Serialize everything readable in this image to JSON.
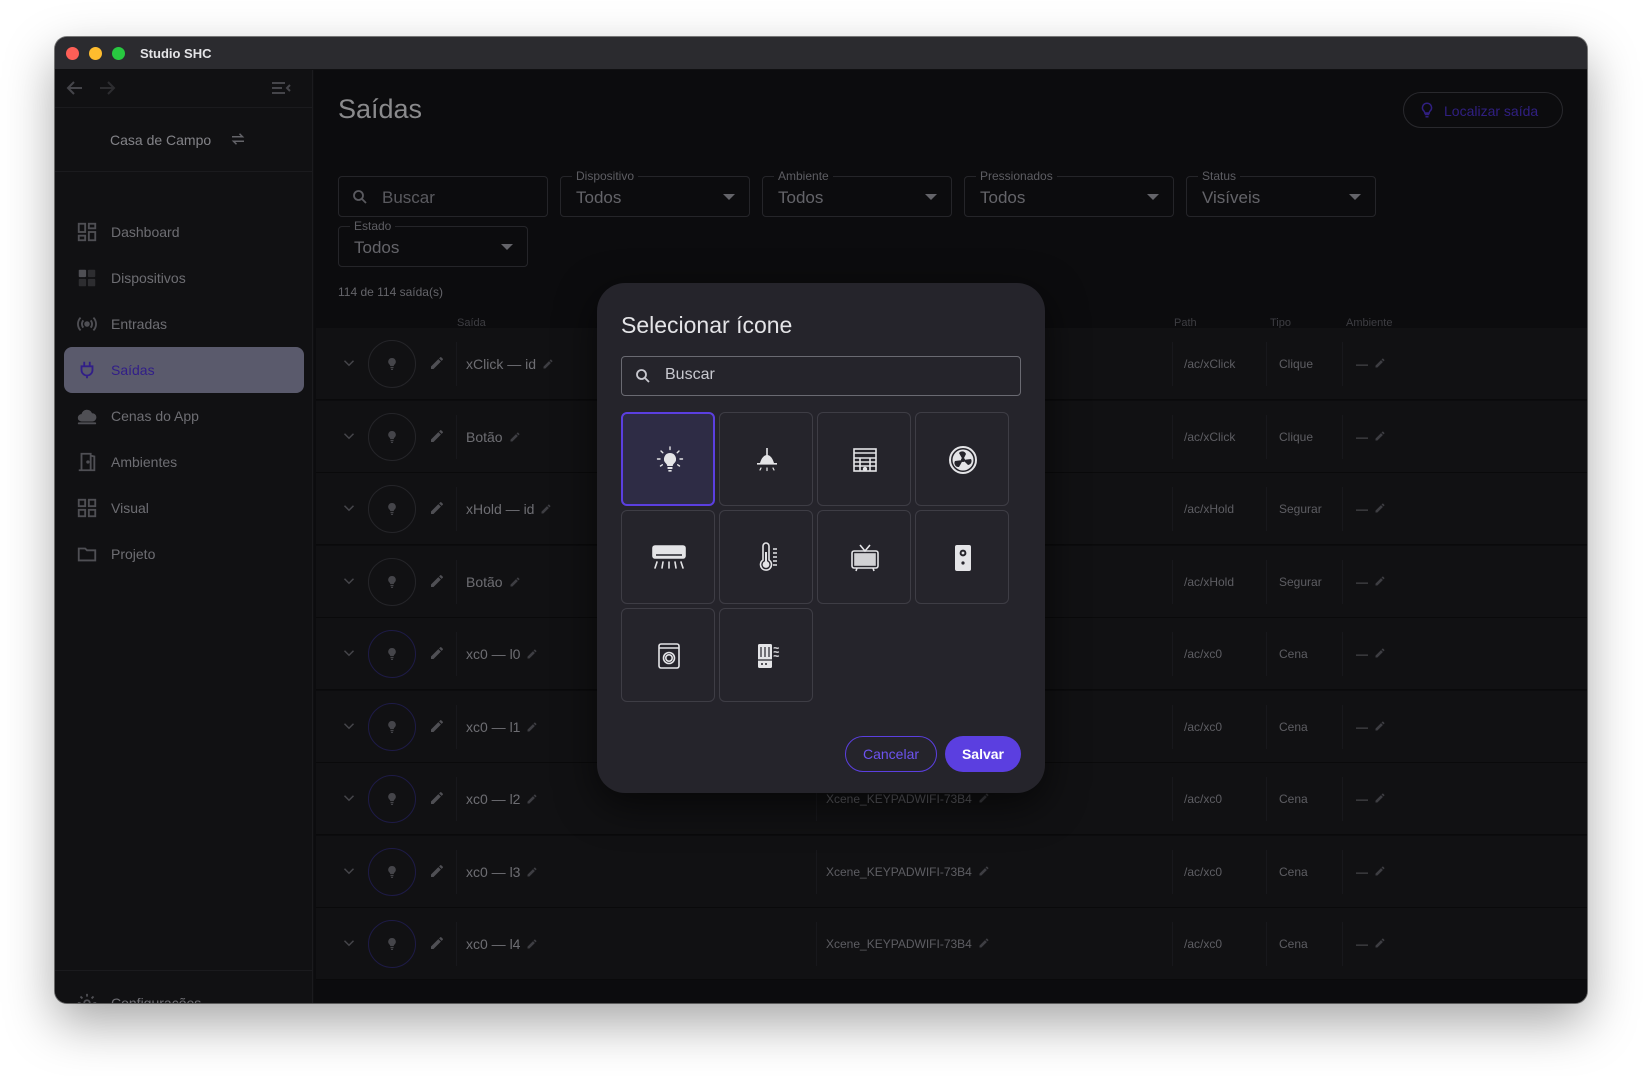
{
  "window": {
    "title": "Studio SHC"
  },
  "sidebar": {
    "project_name": "Casa de Campo",
    "items": [
      {
        "label": "Dashboard",
        "icon": "dashboard-icon"
      },
      {
        "label": "Dispositivos",
        "icon": "devices-icon"
      },
      {
        "label": "Entradas",
        "icon": "broadcast-icon"
      },
      {
        "label": "Saídas",
        "icon": "plug-icon",
        "active": true
      },
      {
        "label": "Cenas do App",
        "icon": "cloud-icon"
      },
      {
        "label": "Ambientes",
        "icon": "door-icon"
      },
      {
        "label": "Visual",
        "icon": "grid-icon"
      },
      {
        "label": "Projeto",
        "icon": "folder-icon"
      }
    ],
    "settings_label": "Configurações"
  },
  "main": {
    "title": "Saídas",
    "locate_button": "Localizar saída",
    "search_placeholder": "Buscar",
    "filters": {
      "device": {
        "label": "Dispositivo",
        "value": "Todos"
      },
      "room": {
        "label": "Ambiente",
        "value": "Todos"
      },
      "pressed": {
        "label": "Pressionados",
        "value": "Todos"
      },
      "status": {
        "label": "Status",
        "value": "Visíveis"
      },
      "state": {
        "label": "Estado",
        "value": "Todos"
      }
    },
    "count_text": "114 de 114 saída(s)",
    "columns": {
      "output": "Saída",
      "path": "Path",
      "type": "Tipo",
      "room": "Ambiente"
    },
    "rows": [
      {
        "name": "xClick — id",
        "device": "",
        "path": "/ac/xClick",
        "type": "Clique",
        "room": "—"
      },
      {
        "name": "Botão",
        "device": "",
        "path": "/ac/xClick",
        "type": "Clique",
        "room": "—"
      },
      {
        "name": "xHold — id",
        "device": "",
        "path": "/ac/xHold",
        "type": "Segurar",
        "room": "—"
      },
      {
        "name": "Botão",
        "device": "",
        "path": "/ac/xHold",
        "type": "Segurar",
        "room": "—"
      },
      {
        "name": "xc0 — l0",
        "device": "",
        "path": "/ac/xc0",
        "type": "Cena",
        "room": "—"
      },
      {
        "name": "xc0 — l1",
        "device": "",
        "path": "/ac/xc0",
        "type": "Cena",
        "room": "—"
      },
      {
        "name": "xc0 — l2",
        "device": "Xcene_KEYPADWIFI-73B4",
        "path": "/ac/xc0",
        "type": "Cena",
        "room": "—"
      },
      {
        "name": "xc0 — l3",
        "device": "Xcene_KEYPADWIFI-73B4",
        "path": "/ac/xc0",
        "type": "Cena",
        "room": "—"
      },
      {
        "name": "xc0 — l4",
        "device": "Xcene_KEYPADWIFI-73B4",
        "path": "/ac/xc0",
        "type": "Cena",
        "room": "—"
      }
    ]
  },
  "modal": {
    "title": "Selecionar ícone",
    "search_placeholder": "Buscar",
    "icons": [
      "lightbulb-icon",
      "pendant-lamp-icon",
      "curtain-icon",
      "fan-icon",
      "air-conditioner-icon",
      "thermostat-icon",
      "tv-icon",
      "speaker-icon",
      "washer-icon",
      "heater-icon"
    ],
    "selected_icon": "lightbulb-icon",
    "cancel_label": "Cancelar",
    "save_label": "Salvar"
  },
  "colors": {
    "accent": "#5b3fe0",
    "active_nav_bg": "#8b8ba6",
    "background": "#131316"
  }
}
